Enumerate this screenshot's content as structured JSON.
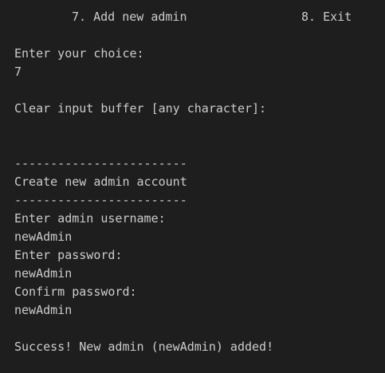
{
  "terminal": {
    "menu_option_7": "7. Add new admin",
    "menu_option_8": "8. Exit",
    "choice_prompt": "Enter your choice:",
    "choice_value": "7",
    "clear_buffer_prompt": "Clear input buffer [any character]:",
    "separator_top": "------------------------",
    "section_title": "Create new admin account",
    "separator_bottom": "------------------------",
    "username_prompt": "Enter admin username:",
    "username_value": "newAdmin",
    "password_prompt": "Enter password:",
    "password_value": "newAdmin",
    "confirm_prompt": "Confirm password:",
    "confirm_value": "newAdmin",
    "success_message": "Success! New admin (newAdmin) added!"
  }
}
